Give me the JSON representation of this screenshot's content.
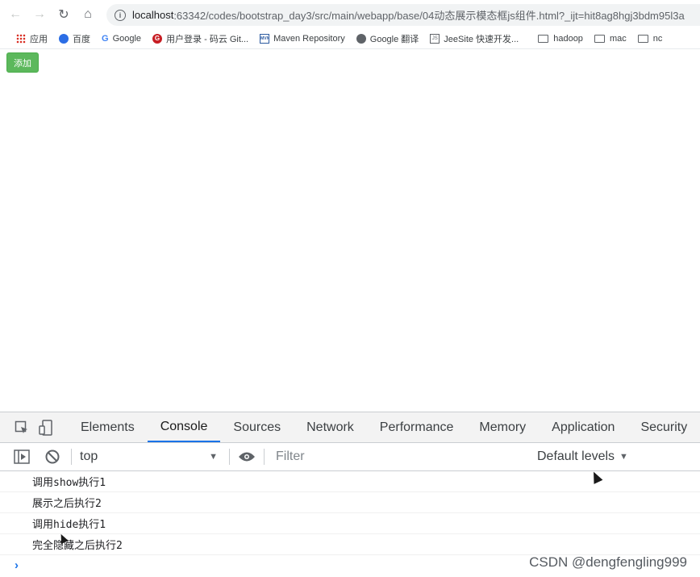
{
  "browser": {
    "url_host": "localhost",
    "url_rest": ":63342/codes/bootstrap_day3/src/main/webapp/base/04动态展示模态框js组件.html?_ijt=hit8ag8hgj3bdm95l3a",
    "bookmarks": [
      {
        "label": "应用",
        "icon": "apps-icon"
      },
      {
        "label": "百度",
        "icon": "baidu-icon"
      },
      {
        "label": "Google",
        "icon": "google-icon"
      },
      {
        "label": "用户登录 - 码云 Git...",
        "icon": "gitee-icon"
      },
      {
        "label": "Maven Repository",
        "icon": "maven-icon"
      },
      {
        "label": "Google 翻译",
        "icon": "translate-icon"
      },
      {
        "label": "JeeSite 快速开发...",
        "icon": "js-icon"
      },
      {
        "label": "hadoop",
        "icon": "folder-icon"
      },
      {
        "label": "mac",
        "icon": "folder-icon"
      },
      {
        "label": "nc",
        "icon": "folder-icon"
      }
    ]
  },
  "page": {
    "add_button_label": "添加",
    "add_button_color": "#5cb85c"
  },
  "devtools": {
    "tabs": [
      "Elements",
      "Console",
      "Sources",
      "Network",
      "Performance",
      "Memory",
      "Application",
      "Security"
    ],
    "active_tab": "Console",
    "context_select": "top",
    "filter_placeholder": "Filter",
    "levels_label": "Default levels",
    "log_lines": [
      "调用show执行1",
      "展示之后执行2",
      "调用hide执行1",
      "完全隐藏之后执行2"
    ],
    "prompt_symbol": "›"
  },
  "watermark": "CSDN @dengfengling999"
}
